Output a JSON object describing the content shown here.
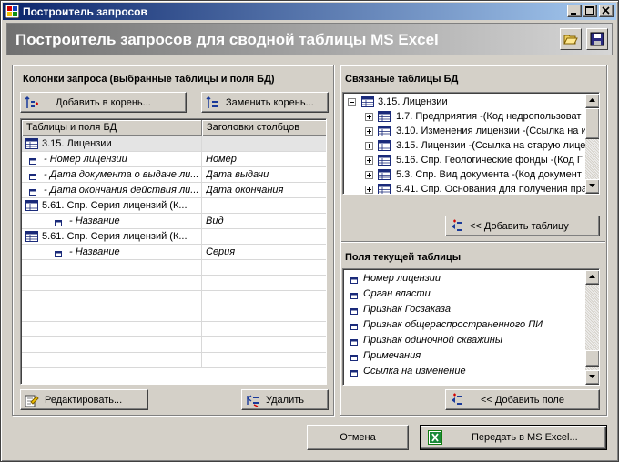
{
  "window": {
    "title": "Построитель запросов",
    "header_title": "Построитель запросов для сводной таблицы MS Excel"
  },
  "left_panel": {
    "title": "Колонки запроса (выбранные таблицы и поля БД)",
    "add_root_label": "Добавить в корень...",
    "replace_root_label": "Заменить корень...",
    "grid": {
      "columns": [
        "Таблицы и поля БД",
        "Заголовки столбцов"
      ],
      "rows": [
        {
          "kind": "table",
          "name": "3.15. Лицензии",
          "header": ""
        },
        {
          "kind": "field",
          "name": "- Номер лицензии",
          "header": "Номер"
        },
        {
          "kind": "field",
          "name": "- Дата документа о выдаче ли...",
          "header": "Дата выдачи"
        },
        {
          "kind": "field",
          "name": "- Дата окончания действия ли...",
          "header": "Дата окончания"
        },
        {
          "kind": "table",
          "name": "5.61. Спр. Серия лицензий (К...",
          "header": ""
        },
        {
          "kind": "subfield",
          "name": "- Название",
          "header": "Вид"
        },
        {
          "kind": "table",
          "name": "5.61. Спр. Серия лицензий (К...",
          "header": ""
        },
        {
          "kind": "subfield",
          "name": "- Название",
          "header": "Серия"
        }
      ]
    },
    "edit_label": "Редактировать...",
    "delete_label": "Удалить"
  },
  "linked_panel": {
    "title": "Связаные таблицы БД",
    "root": "3.15. Лицензии",
    "items": [
      "1.7. Предприятия -(Код недропользоват",
      "3.10. Изменения лицензии -(Ссылка на из",
      "3.15. Лицензии -(Ссылка на старую лице",
      "5.16. Спр. Геологические фонды -(Код Г",
      "5.3. Спр. Вид документа -(Код документ",
      "5.41. Спр. Основания для получения пра"
    ],
    "add_table_label": "<< Добавить таблицу"
  },
  "fields_panel": {
    "title": "Поля текущей таблицы",
    "items": [
      "Номер лицензии",
      "Орган власти",
      "Признак Госзаказа",
      "Признак общераспространенного ПИ",
      "Признак одиночной скважины",
      "Примечания",
      "Ссылка на изменение"
    ],
    "add_field_label": "<< Добавить поле"
  },
  "footer": {
    "cancel_label": "Отмена",
    "send_label": "Передать в MS Excel..."
  },
  "colors": {
    "title_bar_start": "#0a246a",
    "title_bar_end": "#a6caf0",
    "face": "#d4d0c8",
    "selected_row": "#e4e4e4"
  },
  "icons": {
    "app": "app-icon",
    "open": "folder-open-icon",
    "save": "save-icon",
    "add_root": "add-root-icon",
    "replace_root": "replace-root-icon",
    "edit": "edit-icon",
    "delete": "delete-icon",
    "add_table": "add-table-icon",
    "add_field": "add-field-icon",
    "excel": "excel-icon"
  }
}
